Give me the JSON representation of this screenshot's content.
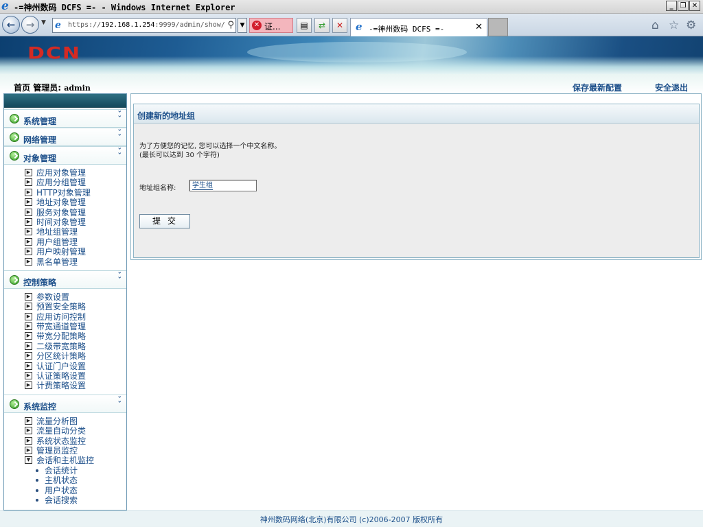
{
  "window": {
    "title": "-=神州数码 DCFS =- - Windows Internet Explorer",
    "minimize": "_",
    "restore": "❐",
    "close": "✕"
  },
  "browser": {
    "url_prefix": "https://",
    "url_host": "192.168.1.254",
    "url_rest": ":9999/admin/show/",
    "cert_label": "证...",
    "tab_title": "-=神州数码 DCFS =-",
    "icons": [
      "back-icon",
      "forward-icon",
      "search-icon",
      "certificate-error-icon",
      "compatibility-view-icon",
      "refresh-icon",
      "stop-icon",
      "home-icon",
      "favorites-star-icon",
      "tools-gear-icon"
    ]
  },
  "banner": {
    "logo": "DCN"
  },
  "header": {
    "home": "首页",
    "admin_label": "管理员:",
    "admin_name": "admin",
    "save_config": "保存最新配置",
    "logout": "安全退出"
  },
  "sidebar": {
    "sections": [
      {
        "label": "系统管理",
        "items": []
      },
      {
        "label": "网络管理",
        "items": []
      },
      {
        "label": "对象管理",
        "items": [
          "应用对象管理",
          "应用分组管理",
          "HTTP对象管理",
          "地址对象管理",
          "服务对象管理",
          "时间对象管理",
          "地址组管理",
          "用户组管理",
          "用户映射管理",
          "黑名单管理"
        ]
      },
      {
        "label": "控制策略",
        "items": [
          "参数设置",
          "预置安全策略",
          "应用访问控制",
          "带宽通道管理",
          "带宽分配策略",
          "二级带宽策略",
          "分区统计策略",
          "认证门户设置",
          "认证策略设置",
          "计费策略设置"
        ]
      },
      {
        "label": "系统监控",
        "items": [
          "流量分析图",
          "流量自动分类",
          "系统状态监控",
          "管理员监控",
          "会话和主机监控"
        ],
        "subitems": [
          "会话统计",
          "主机状态",
          "用户状态",
          "会话搜索"
        ]
      }
    ]
  },
  "form": {
    "title": "创建新的地址组",
    "desc_line1": "为了方便您的记忆, 您可以选择一个中文名称。",
    "desc_line2": "(最长可以达到 30 个字符)",
    "field_label": "地址组名称:",
    "field_value": "学生组",
    "submit_label": "提交"
  },
  "footer": {
    "text": "神州数码网络(北京)有限公司 (c)2006-2007 版权所有"
  }
}
